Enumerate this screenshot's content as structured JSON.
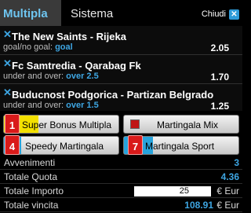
{
  "tabs": {
    "active": "Multipla",
    "other": "Sistema"
  },
  "close": {
    "label": "Chiudi",
    "icon": "x-icon"
  },
  "bets": [
    {
      "title": "The New Saints - Rijeka",
      "market": "goal/no goal: ",
      "selection": "goal",
      "odd": "2.05"
    },
    {
      "title": "Fc Samtredia - Qarabag Fk",
      "market": "under and over: ",
      "selection": "over 2.5",
      "odd": "1.70"
    },
    {
      "title": "Buducnost Podgorica - Partizan Belgrado",
      "market": "under and over: ",
      "selection": "over 1.5",
      "odd": "1.25"
    }
  ],
  "bonuses": [
    {
      "badge": "1",
      "label": "Super Bonus Multipla",
      "fill_color": "#f3e000",
      "fill_fraction": 0.3
    },
    {
      "badge": "",
      "label": "Martingala Mix",
      "fill_color": "",
      "fill_fraction": 0
    },
    {
      "badge": "4",
      "label": "Speedy Martingala",
      "fill_color": "#27a3dc",
      "fill_fraction": 0.15
    },
    {
      "badge": "7",
      "label": "Martingala Sport",
      "fill_color": "#27a3dc",
      "fill_fraction": 0.25
    }
  ],
  "summary": {
    "events_label": "Avvenimenti",
    "events_value": "3",
    "quota_label": "Totale Quota",
    "quota_value": "4.36",
    "amount_label": "Totale Importo",
    "amount_value": "25",
    "amount_unit": "€ Eur",
    "win_label": "Totale vincita",
    "win_value": "108.91",
    "win_unit": "€ Eur"
  },
  "colors": {
    "accent": "#3ea6e3",
    "badge_red": "#d91a1a",
    "yellow": "#f3e000"
  }
}
